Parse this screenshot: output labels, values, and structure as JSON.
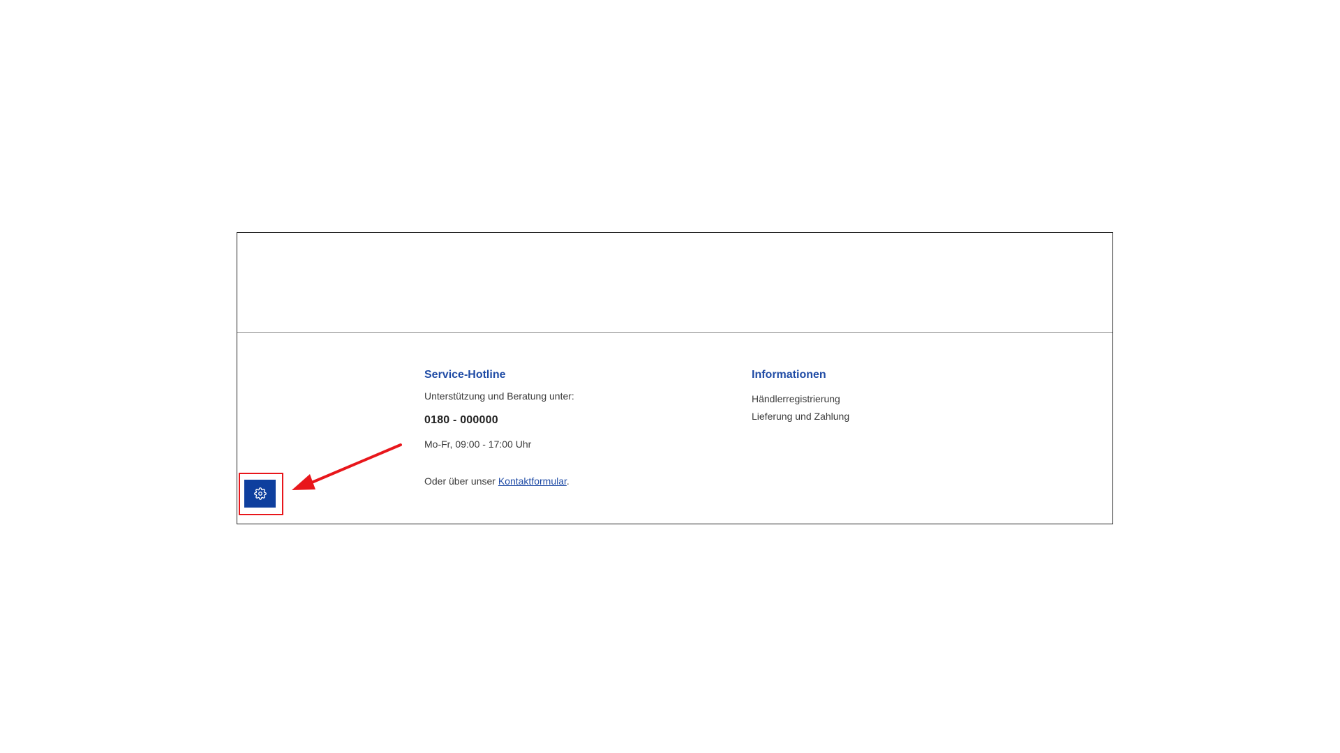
{
  "footer": {
    "hotline": {
      "heading": "Service-Hotline",
      "support_text": "Unterstützung und Beratung unter:",
      "phone": "0180 - 000000",
      "hours": "Mo-Fr, 09:00 - 17:00 Uhr",
      "contact_prefix": "Oder über unser ",
      "contact_link": "Kontaktformular",
      "contact_suffix": "."
    },
    "information": {
      "heading": "Informationen",
      "links": [
        "Händlerregistrierung",
        "Lieferung und Zahlung"
      ]
    }
  },
  "settings_button": {
    "icon": "gear-icon",
    "background": "#0e3f9e"
  },
  "annotation": {
    "highlight_color": "#e8161b",
    "arrow_color": "#e8161b"
  },
  "colors": {
    "accent": "#1f4ba5",
    "text": "#3a3a3a"
  }
}
